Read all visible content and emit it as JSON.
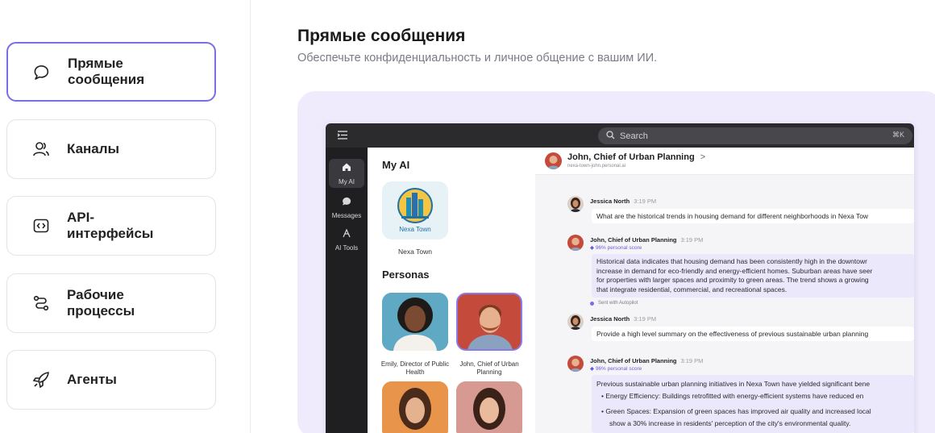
{
  "sidebar": {
    "items": [
      {
        "label": "Прямые\nсообщения",
        "icon": "chat-bubble-icon"
      },
      {
        "label": "Каналы",
        "icon": "users-icon"
      },
      {
        "label": "API-\nинтерфейсы",
        "icon": "code-icon"
      },
      {
        "label": "Рабочие\nпроцессы",
        "icon": "workflow-icon"
      },
      {
        "label": "Агенты",
        "icon": "rocket-icon"
      }
    ],
    "active_index": 0
  },
  "header": {
    "title": "Прямые сообщения",
    "subtitle": "Обеспечьте конфиденциальность и личное общение с вашим ИИ."
  },
  "preview": {
    "search_placeholder": "Search",
    "search_shortcut": "⌘K",
    "rail": [
      {
        "label": "My AI",
        "icon": "home-icon"
      },
      {
        "label": "Messages",
        "icon": "messages-icon"
      },
      {
        "label": "AI Tools",
        "icon": "tools-icon"
      }
    ],
    "my_ai_title": "My AI",
    "nexa_logo_text": "Nexa Town",
    "nexa_label": "Nexa Town",
    "personas_title": "Personas",
    "personas": [
      {
        "caption": "Emily, Director of Public Health"
      },
      {
        "caption": "John, Chief of Urban Planning"
      }
    ],
    "chat": {
      "title": "John, Chief of Urban Planning",
      "chevron": ">",
      "subtitle": "nexa-town-john.personal.ai",
      "messages": [
        {
          "author": "Jessica North",
          "time": "3:19 PM",
          "text": "What are the historical trends in housing demand for different neighborhoods in Nexa Tow"
        },
        {
          "author": "John, Chief of Urban Planning",
          "time": "3:19 PM",
          "score": "96% personal score",
          "lines": [
            "Historical data indicates that housing demand has been consistently high in the downtowr",
            "increase in demand for eco-friendly and energy-efficient homes. Suburban areas have seer",
            "for properties with larger spaces and proximity to green areas. The trend shows a growing",
            "that integrate residential, commercial, and recreational spaces."
          ]
        },
        {
          "author": "Jessica North",
          "time": "3:19 PM",
          "text": "Provide a high level summary on the effectiveness of previous sustainable urban planning"
        },
        {
          "author": "John, Chief of Urban Planning",
          "time": "3:19 PM",
          "score": "96% personal score",
          "lines": [
            "Previous sustainable urban planning initiatives in Nexa Town have yielded significant bene",
            "•  Energy Efficiency: Buildings retrofitted with energy-efficient systems have reduced en",
            "•  Green Spaces: Expansion of green spaces has improved air quality and increased local",
            "show a 30% increase in residents' perception of the city's environmental quality."
          ]
        }
      ],
      "autopilot": "Sent with Autopilot"
    }
  }
}
